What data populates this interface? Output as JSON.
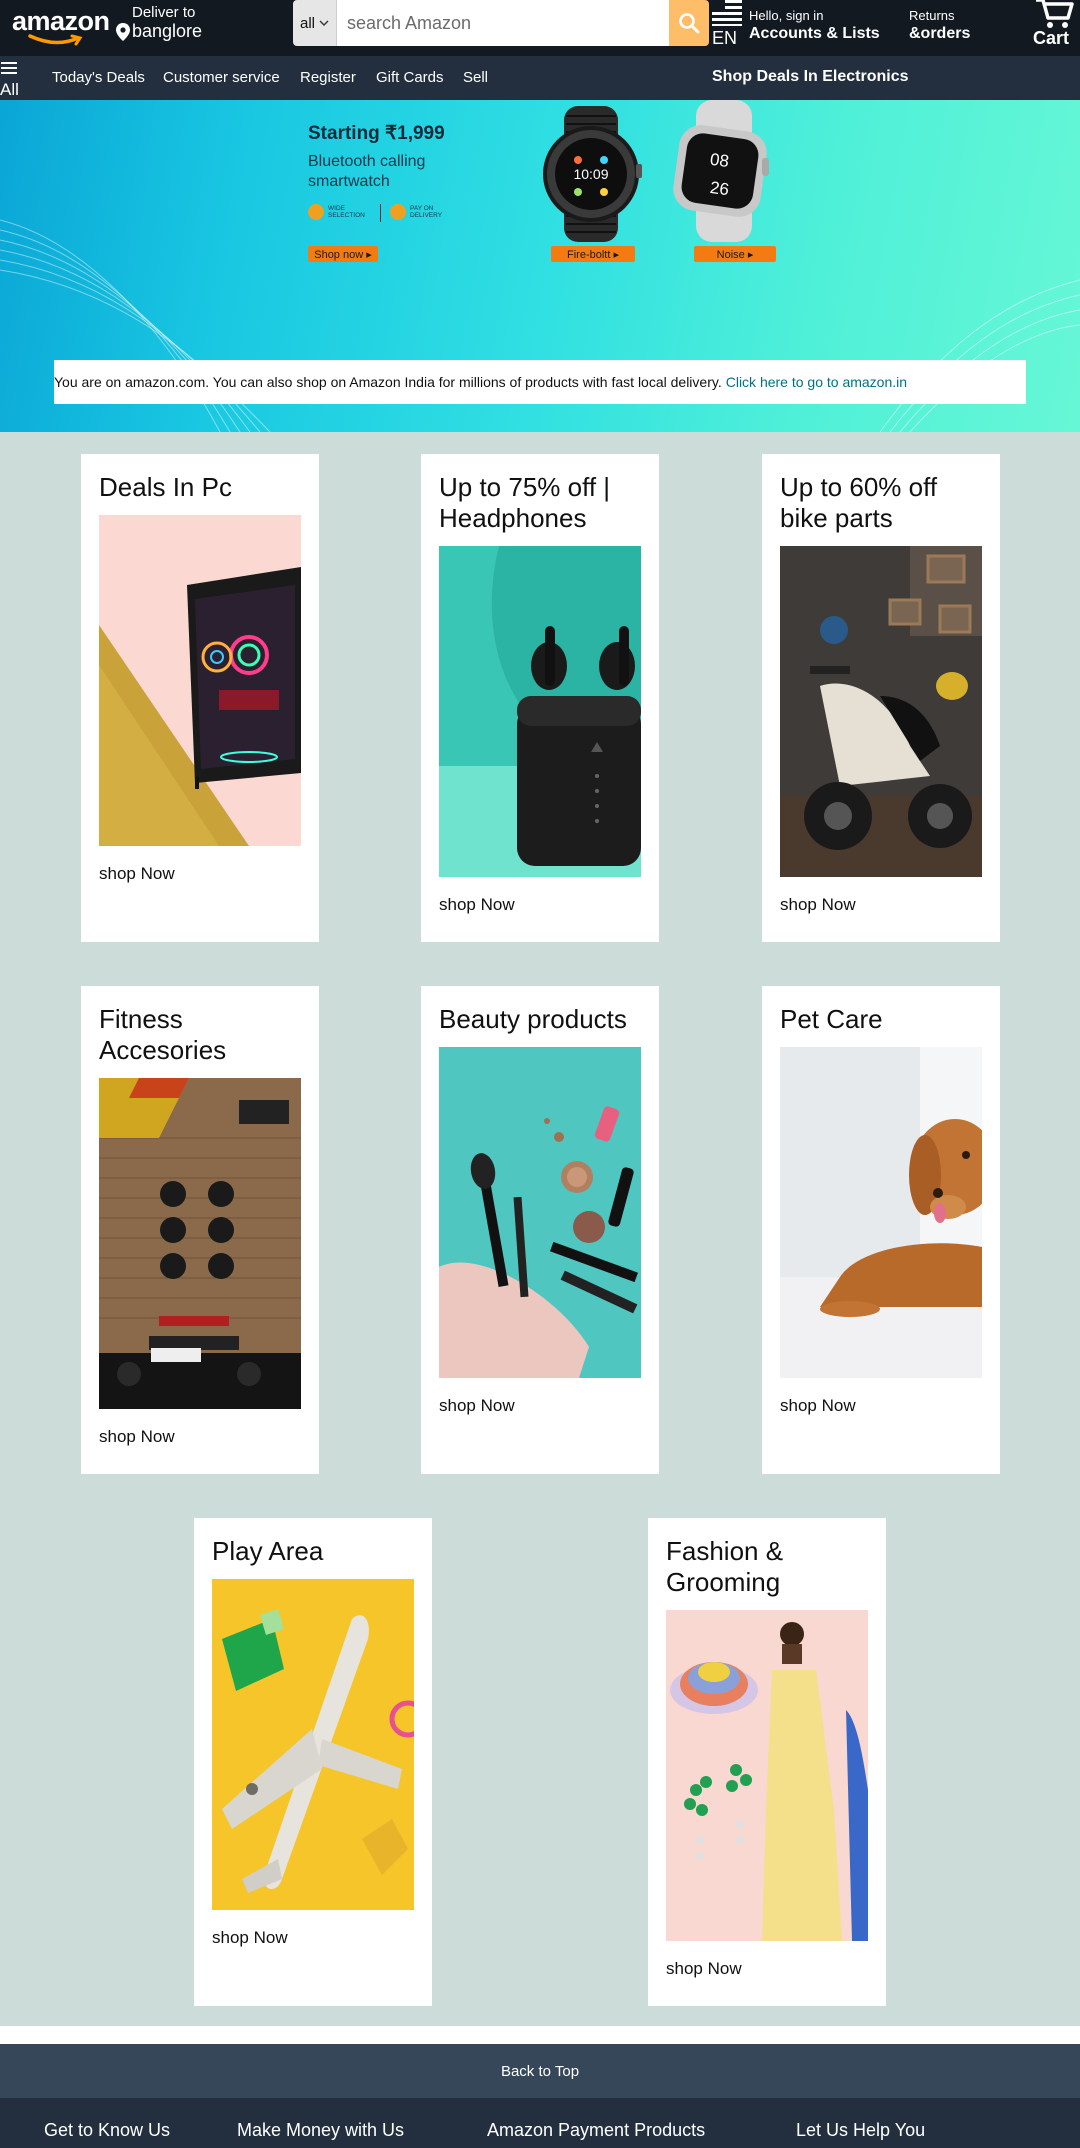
{
  "header": {
    "logo_text": "amazon",
    "deliver_label": "Deliver to",
    "deliver_location": "banglore",
    "search_category": "all",
    "search_placeholder": "search Amazon",
    "language": "EN",
    "account_greeting": "Hello, sign in",
    "account_label": "Accounts & Lists",
    "returns_label": "Returns",
    "orders_label": "&orders",
    "cart_label": "Cart"
  },
  "subnav": {
    "all_label": "All",
    "items": [
      "Today's Deals",
      "Customer service",
      "Register",
      "Gift Cards",
      "Sell"
    ],
    "promo": "Shop Deals In Electronics"
  },
  "hero": {
    "title": "Starting ₹1,999",
    "subtitle": "Bluetooth calling smartwatch",
    "feature_1": "Wide selection",
    "feature_2": "Pay on delivery",
    "shop_now": "Shop now ▸",
    "watch_1_label": "Fire-boltt ▸",
    "watch_2_label": "Noise ▸",
    "watch_1_time": "10:09",
    "watch_2_hour": "08",
    "watch_2_min": "26",
    "notice_text": "You are on amazon.com. You can also shop on Amazon India for millions of products with fast local delivery.",
    "notice_link": "Click here to go to amazon.in"
  },
  "cards": [
    {
      "title": "Deals In Pc",
      "cta": "shop Now"
    },
    {
      "title": "Up to 75% off | Headphones",
      "cta": "shop Now"
    },
    {
      "title": "Up to 60% off bike parts",
      "cta": "shop Now"
    },
    {
      "title": "Fitness Accesories",
      "cta": "shop Now"
    },
    {
      "title": "Beauty products",
      "cta": "shop Now"
    },
    {
      "title": "Pet Care",
      "cta": "shop Now"
    },
    {
      "title": "Play Area",
      "cta": "shop Now"
    },
    {
      "title": "Fashion & Grooming",
      "cta": "shop Now"
    }
  ],
  "footer": {
    "back_to_top": "Back to Top",
    "columns": [
      "Get to Know Us",
      "Make Money with Us",
      "Amazon Payment Products",
      "Let Us Help You"
    ]
  },
  "colors": {
    "nav_dark": "#131921",
    "nav_secondary": "#232f3e",
    "search_button": "#febd69",
    "grid_background": "#ccdcd8",
    "link": "#007185"
  }
}
